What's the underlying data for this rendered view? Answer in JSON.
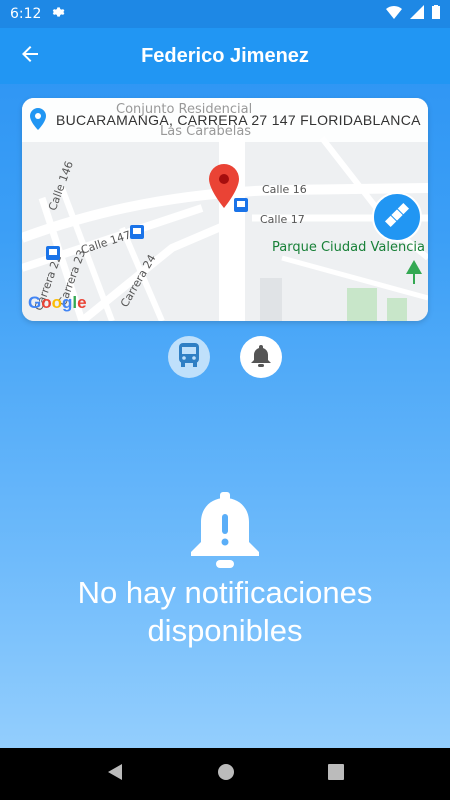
{
  "status_bar": {
    "time": "6:12"
  },
  "header": {
    "title": "Federico Jimenez"
  },
  "map": {
    "address": "BUCARAMANGA, CARRERA 27 147 FLORIDABLANCA",
    "place_label_line1": "Conjunto Residencial",
    "place_label_line2": "Las Carabelas",
    "streets": [
      "Calle 16",
      "Calle 17",
      "Calle 146",
      "Calle 147",
      "Carrera 22",
      "Carrera 23",
      "Carrera 24"
    ],
    "park": "Parque Ciudad Valencia",
    "logo": "Google"
  },
  "buttons": {
    "bus_icon": "bus-icon",
    "bell_icon": "bell-icon"
  },
  "empty_state": {
    "message": "No hay notificaciones disponibles"
  },
  "colors": {
    "primary": "#2196f3",
    "marker": "#ea4335",
    "park_green": "#188038"
  }
}
